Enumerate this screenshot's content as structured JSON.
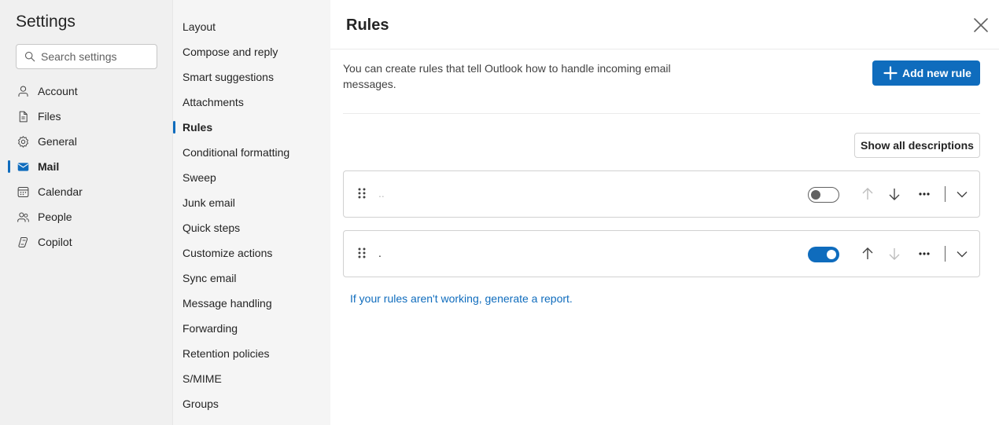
{
  "settings": {
    "title": "Settings",
    "search_placeholder": "Search settings",
    "categories": [
      {
        "label": "Account",
        "icon": "person-icon"
      },
      {
        "label": "Files",
        "icon": "document-icon"
      },
      {
        "label": "General",
        "icon": "gear-icon"
      },
      {
        "label": "Mail",
        "icon": "mail-icon",
        "active": true
      },
      {
        "label": "Calendar",
        "icon": "calendar-icon"
      },
      {
        "label": "People",
        "icon": "people-icon"
      },
      {
        "label": "Copilot",
        "icon": "copilot-icon"
      }
    ]
  },
  "mail_menu": {
    "items": [
      "Layout",
      "Compose and reply",
      "Smart suggestions",
      "Attachments",
      "Rules",
      "Conditional formatting",
      "Sweep",
      "Junk email",
      "Quick steps",
      "Customize actions",
      "Sync email",
      "Message handling",
      "Forwarding",
      "Retention policies",
      "S/MIME",
      "Groups"
    ],
    "active": "Rules"
  },
  "rules_panel": {
    "title": "Rules",
    "description": "You can create rules that tell Outlook how to handle incoming email messages.",
    "add_button": "Add new rule",
    "show_descriptions_button": "Show all descriptions",
    "rules": [
      {
        "name": "..",
        "enabled": false
      },
      {
        "name": ".",
        "enabled": true
      }
    ],
    "report_link": "If your rules aren't working, generate a report."
  },
  "colors": {
    "accent": "#0f6cbd",
    "sidebar_bg": "#f0f0f0",
    "menu_bg": "#f5f5f5"
  }
}
